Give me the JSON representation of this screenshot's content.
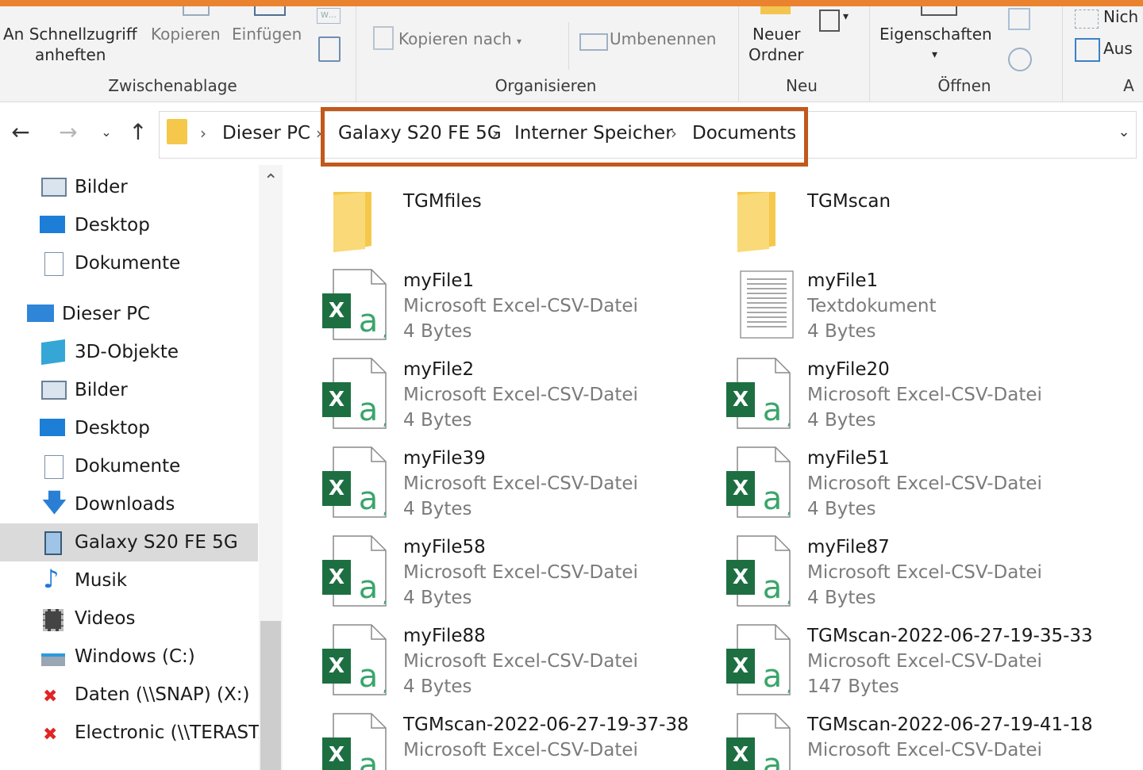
{
  "ribbon": {
    "pin_label_1": "An Schnellzugriff",
    "pin_label_2": "anheften",
    "copy_label": "Kopieren",
    "paste_label": "Einfügen",
    "clipboard_group": "Zwischenablage",
    "copy_to_label": "Kopieren nach",
    "rename_label": "Umbenennen",
    "organize_group": "Organisieren",
    "new_folder_1": "Neuer",
    "new_folder_2": "Ordner",
    "new_group": "Neu",
    "properties_label": "Eigenschaften",
    "open_group": "Öffnen",
    "select_none_label": "Nich",
    "invert_label": "Aus",
    "select_group": "A"
  },
  "address": {
    "this_pc": "Dieser PC",
    "device": "Galaxy S20 FE 5G",
    "storage": "Interner Speicher",
    "folder": "Documents"
  },
  "sidebar": {
    "items": [
      {
        "label": "Bilder"
      },
      {
        "label": "Desktop"
      },
      {
        "label": "Dokumente"
      },
      {
        "label": "Dieser PC"
      },
      {
        "label": "3D-Objekte"
      },
      {
        "label": "Bilder"
      },
      {
        "label": "Desktop"
      },
      {
        "label": "Dokumente"
      },
      {
        "label": "Downloads"
      },
      {
        "label": "Galaxy S20 FE 5G"
      },
      {
        "label": "Musik"
      },
      {
        "label": "Videos"
      },
      {
        "label": "Windows (C:)"
      },
      {
        "label": "Daten (\\\\SNAP) (X:)"
      },
      {
        "label": "Electronic (\\\\TERASTA"
      }
    ]
  },
  "files": [
    {
      "name": "TGMfiles",
      "type": "",
      "size": "",
      "icon": "folder-icon"
    },
    {
      "name": "TGMscan",
      "type": "",
      "size": "",
      "icon": "folder-icon"
    },
    {
      "name": "myFile1",
      "type": "Microsoft Excel-CSV-Datei",
      "size": "4 Bytes",
      "icon": "excel-csv-icon"
    },
    {
      "name": "myFile1",
      "type": "Textdokument",
      "size": "4 Bytes",
      "icon": "text-document-icon"
    },
    {
      "name": "myFile2",
      "type": "Microsoft Excel-CSV-Datei",
      "size": "4 Bytes",
      "icon": "excel-csv-icon"
    },
    {
      "name": "myFile20",
      "type": "Microsoft Excel-CSV-Datei",
      "size": "4 Bytes",
      "icon": "excel-csv-icon"
    },
    {
      "name": "myFile39",
      "type": "Microsoft Excel-CSV-Datei",
      "size": "4 Bytes",
      "icon": "excel-csv-icon"
    },
    {
      "name": "myFile51",
      "type": "Microsoft Excel-CSV-Datei",
      "size": "4 Bytes",
      "icon": "excel-csv-icon"
    },
    {
      "name": "myFile58",
      "type": "Microsoft Excel-CSV-Datei",
      "size": "4 Bytes",
      "icon": "excel-csv-icon"
    },
    {
      "name": "myFile87",
      "type": "Microsoft Excel-CSV-Datei",
      "size": "4 Bytes",
      "icon": "excel-csv-icon"
    },
    {
      "name": "myFile88",
      "type": "Microsoft Excel-CSV-Datei",
      "size": "4 Bytes",
      "icon": "excel-csv-icon"
    },
    {
      "name": "TGMscan-2022-06-27-19-35-33",
      "type": "Microsoft Excel-CSV-Datei",
      "size": "147 Bytes",
      "icon": "excel-csv-icon"
    },
    {
      "name": "TGMscan-2022-06-27-19-37-38",
      "type": "Microsoft Excel-CSV-Datei",
      "size": "",
      "icon": "excel-csv-icon"
    },
    {
      "name": "TGMscan-2022-06-27-19-41-18",
      "type": "Microsoft Excel-CSV-Datei",
      "size": "",
      "icon": "excel-csv-icon"
    }
  ],
  "colors": {
    "accent_bar": "#e9832f",
    "highlight_border": "#c2581a",
    "excel_green": "#1d6f42",
    "folder_yellow": "#f5c84c"
  }
}
